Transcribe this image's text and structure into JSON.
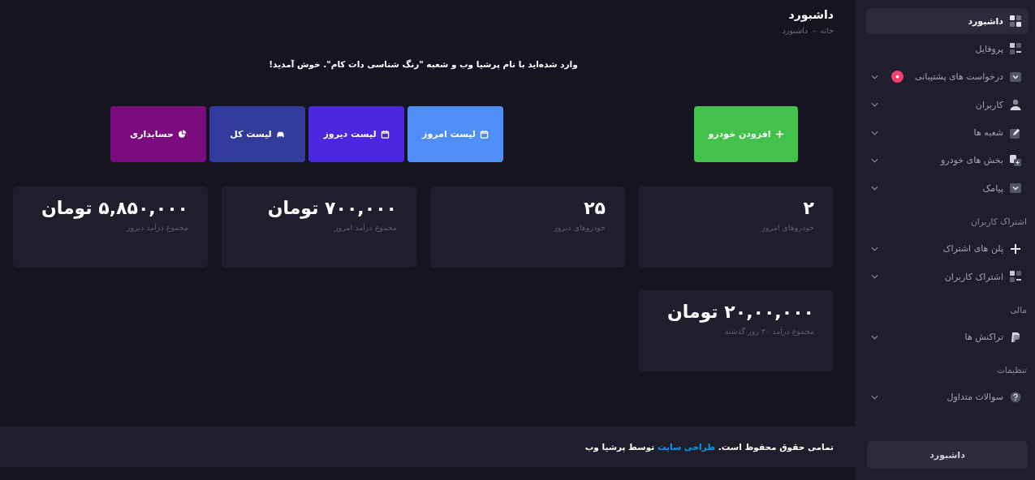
{
  "header": {
    "title": "داشبورد",
    "breadcrumb": "خانه  -  داشبورد"
  },
  "welcome": "وارد شده‌اید با نام پرشیا وب و شعبه \"رنگ شناسی دات کام\". خوش آمدید!",
  "primary_action": {
    "label": "افزودن خودرو",
    "color": "#43c14a"
  },
  "actions": [
    {
      "label": "لیست امروز",
      "color": "#4f8ef7"
    },
    {
      "label": "لیست دیروز",
      "color": "#4b28e0"
    },
    {
      "label": "لیست کل",
      "color": "#323c9c"
    },
    {
      "label": "حسابداری",
      "color": "#7b0c80"
    }
  ],
  "stats": [
    {
      "value": "۲",
      "label": "خودروهای امروز"
    },
    {
      "value": "۲۵",
      "label": "خودروهای دیروز"
    },
    {
      "value": "۷۰۰,۰۰۰ تومان",
      "label": "مجموع درآمد امروز"
    },
    {
      "value": "۵,۸۵۰,۰۰۰ تومان",
      "label": "مجموع درآمد دیروز"
    },
    {
      "value": "۲۰,۰۰,۰۰۰ تومان",
      "label": "مجموع درآمد ۳۰ روز گذشته"
    }
  ],
  "footer": {
    "before": "تمامی حقوق محفوظ است.",
    "link": "طراحی سایت",
    "after": "توسط پرشیا وب"
  },
  "sidebar": {
    "items": [
      {
        "kind": "link",
        "label": "داشبورد",
        "selected": true,
        "expandable": false,
        "badge": false
      },
      {
        "kind": "link",
        "label": "پروفایل",
        "selected": false,
        "expandable": false,
        "badge": false
      },
      {
        "kind": "link",
        "label": "درخواست های پشتیبانی",
        "selected": false,
        "expandable": true,
        "badge": true
      },
      {
        "kind": "link",
        "label": "کاربران",
        "selected": false,
        "expandable": true,
        "badge": false
      },
      {
        "kind": "link",
        "label": "شعبه ها",
        "selected": false,
        "expandable": true,
        "badge": false
      },
      {
        "kind": "link",
        "label": "بخش های خودرو",
        "selected": false,
        "expandable": true,
        "badge": false
      },
      {
        "kind": "link",
        "label": "پیامک",
        "selected": false,
        "expandable": true,
        "badge": false
      },
      {
        "kind": "section",
        "label": "اشتراک کاربران"
      },
      {
        "kind": "link",
        "label": "پلن های اشتراک",
        "selected": false,
        "expandable": true,
        "badge": false
      },
      {
        "kind": "link",
        "label": "اشتراک کاربران",
        "selected": false,
        "expandable": true,
        "badge": false
      },
      {
        "kind": "section",
        "label": "مالی"
      },
      {
        "kind": "link",
        "label": "تراکنش ها",
        "selected": false,
        "expandable": true,
        "badge": false
      },
      {
        "kind": "section",
        "label": "تنظیمات"
      },
      {
        "kind": "link",
        "label": "سوالات متداول",
        "selected": false,
        "expandable": true,
        "badge": false
      }
    ],
    "bottom_button": "داشبورد"
  }
}
